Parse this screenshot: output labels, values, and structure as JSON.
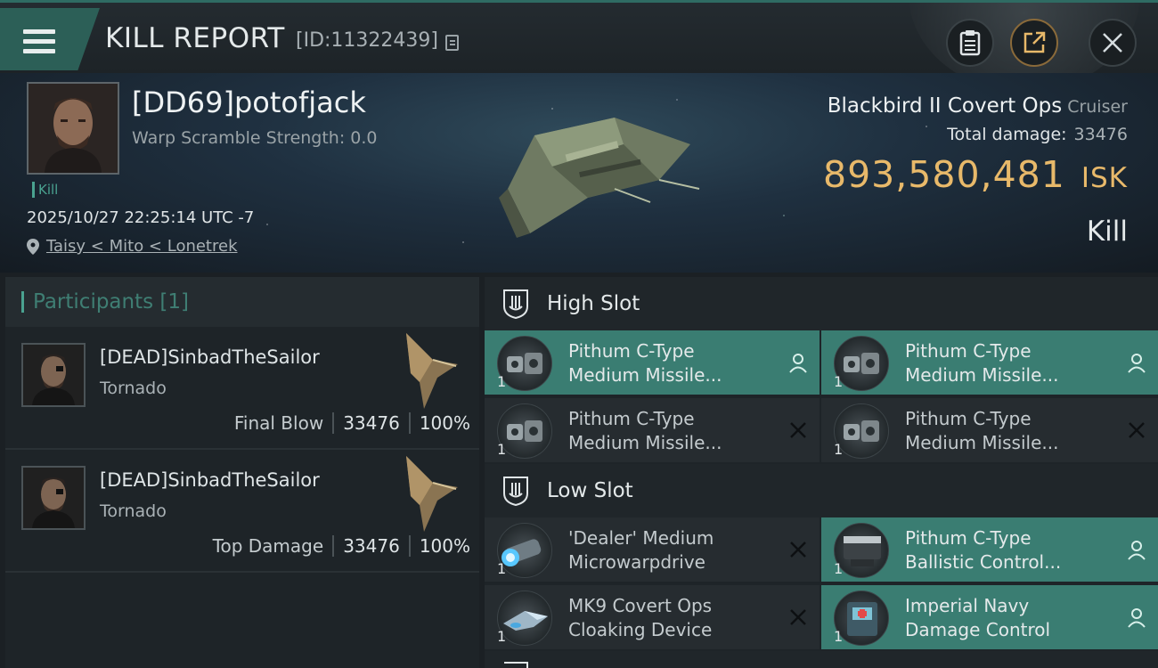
{
  "header": {
    "title": "KILL REPORT",
    "kill_id": "[ID:11322439]",
    "buttons": [
      "clipboard-icon",
      "share-icon",
      "close-icon"
    ]
  },
  "victim": {
    "name": "[DD69]potofjack",
    "warp_scramble": "Warp Scramble Strength: 0.0",
    "tag": "Kill",
    "time": "2025/10/27 22:25:14 UTC -7",
    "location": "Taisy < Mito < Lonetrek",
    "ship": "Blackbird II Covert Ops",
    "ship_class": "Cruiser",
    "total_damage_label": "Total damage:",
    "total_damage": "33476",
    "isk_value": "893,580,481",
    "isk_unit": "ISK",
    "result": "Kill"
  },
  "participants": {
    "title": "Participants [1]",
    "rows": [
      {
        "name": "[DEAD]SinbadTheSailor",
        "ship": "Tornado",
        "label": "Final Blow",
        "damage": "33476",
        "percent": "100%"
      },
      {
        "name": "[DEAD]SinbadTheSailor",
        "ship": "Tornado",
        "label": "Top Damage",
        "damage": "33476",
        "percent": "100%"
      }
    ]
  },
  "fitting": {
    "high_slot": "High Slot",
    "low_slot": "Low Slot",
    "high": [
      {
        "qty": "1",
        "line1": "Pithum C-Type",
        "line2": "Medium Missile...",
        "state": "fitted",
        "icon": "missile-launcher-icon"
      },
      {
        "qty": "1",
        "line1": "Pithum C-Type",
        "line2": "Medium Missile...",
        "state": "fitted",
        "icon": "missile-launcher-icon"
      },
      {
        "qty": "1",
        "line1": "Pithum C-Type",
        "line2": "Medium Missile...",
        "state": "destroyed",
        "icon": "missile-launcher-icon"
      },
      {
        "qty": "1",
        "line1": "Pithum C-Type",
        "line2": "Medium Missile...",
        "state": "destroyed",
        "icon": "missile-launcher-icon"
      }
    ],
    "low": [
      {
        "qty": "1",
        "line1": "'Dealer' Medium",
        "line2": "Microwarpdrive",
        "state": "destroyed",
        "icon": "microwarpdrive-icon"
      },
      {
        "qty": "1",
        "line1": "Pithum C-Type",
        "line2": "Ballistic Control...",
        "state": "fitted",
        "icon": "ballistic-control-icon"
      },
      {
        "qty": "1",
        "line1": "MK9 Covert Ops",
        "line2": "Cloaking Device",
        "state": "destroyed",
        "icon": "cloaking-device-icon"
      },
      {
        "qty": "1",
        "line1": "Imperial Navy",
        "line2": "Damage Control",
        "state": "fitted",
        "icon": "damage-control-icon"
      }
    ]
  },
  "colors": {
    "accent": "#4aa290",
    "isk": "#e8b96a",
    "active_slot": "#3a7d72"
  }
}
